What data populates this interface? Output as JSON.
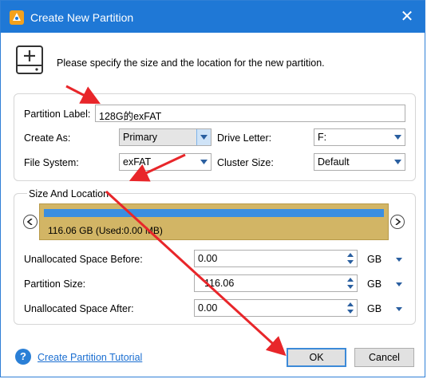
{
  "window": {
    "title": "Create New Partition",
    "close_glyph": "✕"
  },
  "header": {
    "instruction": "Please specify the size and the location for the new partition."
  },
  "form": {
    "partition_label": {
      "label": "Partition Label:",
      "value": "128G的exFAT"
    },
    "create_as": {
      "label": "Create As:",
      "value": "Primary"
    },
    "drive_letter": {
      "label": "Drive Letter:",
      "value": "F:"
    },
    "file_system": {
      "label": "File System:",
      "value": "exFAT"
    },
    "cluster_size": {
      "label": "Cluster Size:",
      "value": "Default"
    }
  },
  "size_location": {
    "title": "Size And Location",
    "disk_text": "116.06 GB (Used:0.00 MB)",
    "unallocated_before": {
      "label": "Unallocated Space Before:",
      "value": "0.00",
      "unit": "GB"
    },
    "partition_size": {
      "label": "Partition Size:",
      "value": "116.06",
      "unit": "GB"
    },
    "unallocated_after": {
      "label": "Unallocated Space After:",
      "value": "0.00",
      "unit": "GB"
    }
  },
  "footer": {
    "help_glyph": "?",
    "tutorial_link": "Create Partition Tutorial",
    "ok_label": "OK",
    "cancel_label": "Cancel"
  },
  "colors": {
    "titlebar": "#1f78d6",
    "disk_bar": "#d2b565",
    "used_bar": "#3a8ee0",
    "arrow": "#e8262a"
  }
}
